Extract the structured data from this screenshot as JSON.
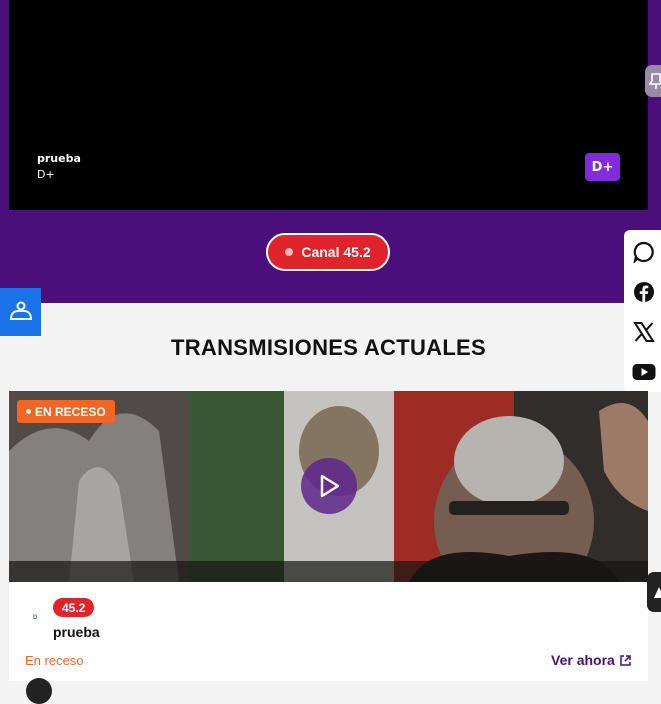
{
  "player": {
    "title": "prueba",
    "subtitle": "D+",
    "badge": "D+"
  },
  "channel_pill": {
    "label": "Canal 45.2"
  },
  "section": {
    "heading": "TRANSMISIONES ACTUALES"
  },
  "card": {
    "live_badge": "EN RECESO",
    "channel_badge": "45.2",
    "channel_logo": "D",
    "title": "prueba",
    "status": "En receso",
    "watch_label": "Ver ahora"
  },
  "social": {
    "items": [
      "chat-icon",
      "facebook-icon",
      "x-icon",
      "youtube-icon"
    ]
  },
  "colors": {
    "brand_purple": "#4a0f7b",
    "accent_red": "#e0242b",
    "status_orange": "#f26522",
    "accessibility_blue": "#1a73e8",
    "badge_purple": "#7f2cdb"
  }
}
